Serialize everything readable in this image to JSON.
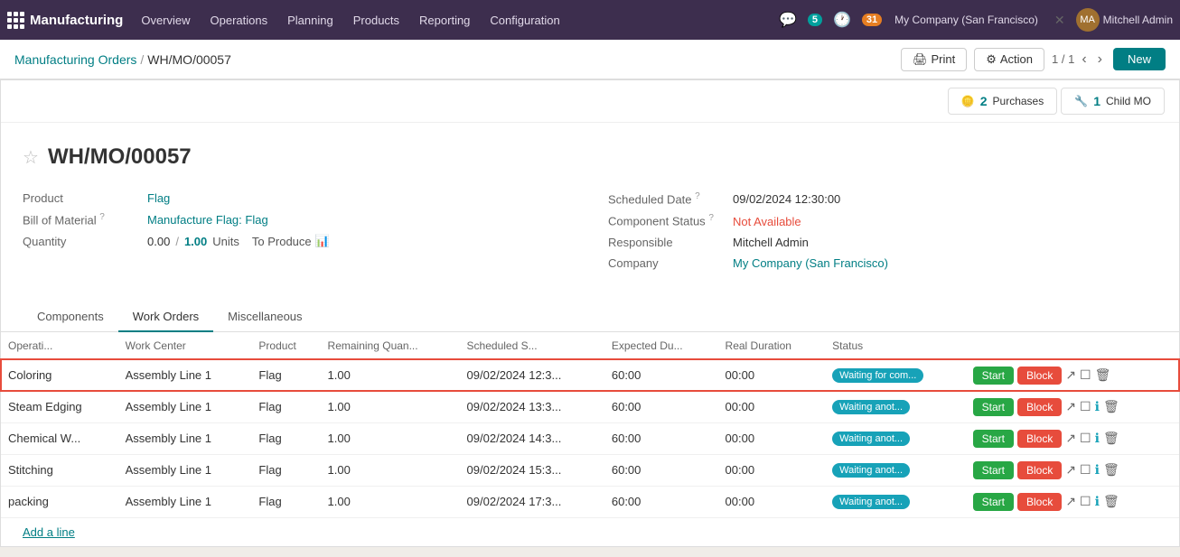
{
  "navbar": {
    "app_name": "Manufacturing",
    "nav_items": [
      "Overview",
      "Operations",
      "Planning",
      "Products",
      "Reporting",
      "Configuration"
    ],
    "badge_messages": "5",
    "badge_activity": "31",
    "company": "My Company (San Francisco)",
    "user": "Mitchell Admin"
  },
  "breadcrumb": {
    "parent": "Manufacturing Orders",
    "separator": "/",
    "current": "WH/MO/00057"
  },
  "toolbar": {
    "print_label": "Print",
    "action_label": "Action",
    "page_info": "1 / 1",
    "new_label": "New"
  },
  "smart_buttons": {
    "purchases_count": "2",
    "purchases_label": "Purchases",
    "child_mo_count": "1",
    "child_mo_label": "Child MO"
  },
  "form": {
    "title": "WH/MO/00057",
    "product_label": "Product",
    "product_value": "Flag",
    "bom_label": "Bill of Material",
    "bom_help": "?",
    "bom_value": "Manufacture Flag: Flag",
    "quantity_label": "Quantity",
    "quantity_current": "0.00",
    "quantity_target": "1.00",
    "quantity_unit": "Units",
    "to_produce_label": "To Produce",
    "scheduled_date_label": "Scheduled Date",
    "scheduled_date_help": "?",
    "scheduled_date_value": "09/02/2024 12:30:00",
    "component_status_label": "Component Status",
    "component_status_help": "?",
    "component_status_value": "Not Available",
    "responsible_label": "Responsible",
    "responsible_value": "Mitchell Admin",
    "company_label": "Company",
    "company_value": "My Company (San Francisco)"
  },
  "tabs": [
    {
      "label": "Components",
      "active": false
    },
    {
      "label": "Work Orders",
      "active": true
    },
    {
      "label": "Miscellaneous",
      "active": false
    }
  ],
  "table": {
    "columns": [
      "Operati...",
      "Work Center",
      "Product",
      "Remaining Quan...",
      "Scheduled S...",
      "Expected Du...",
      "Real Duration",
      "Status"
    ],
    "rows": [
      {
        "operation": "Coloring",
        "work_center": "Assembly Line 1",
        "product": "Flag",
        "remaining_qty": "1.00",
        "scheduled_start": "09/02/2024 12:3...",
        "expected_duration": "60:00",
        "real_duration": "00:00",
        "status": "Waiting for com...",
        "status_class": "waiting-comp",
        "highlighted": true
      },
      {
        "operation": "Steam Edging",
        "work_center": "Assembly Line 1",
        "product": "Flag",
        "remaining_qty": "1.00",
        "scheduled_start": "09/02/2024 13:3...",
        "expected_duration": "60:00",
        "real_duration": "00:00",
        "status": "Waiting anot...",
        "status_class": "waiting-anot",
        "highlighted": false
      },
      {
        "operation": "Chemical W...",
        "work_center": "Assembly Line 1",
        "product": "Flag",
        "remaining_qty": "1.00",
        "scheduled_start": "09/02/2024 14:3...",
        "expected_duration": "60:00",
        "real_duration": "00:00",
        "status": "Waiting anot...",
        "status_class": "waiting-anot",
        "highlighted": false
      },
      {
        "operation": "Stitching",
        "work_center": "Assembly Line 1",
        "product": "Flag",
        "remaining_qty": "1.00",
        "scheduled_start": "09/02/2024 15:3...",
        "expected_duration": "60:00",
        "real_duration": "00:00",
        "status": "Waiting anot...",
        "status_class": "waiting-anot",
        "highlighted": false
      },
      {
        "operation": "packing",
        "work_center": "Assembly Line 1",
        "product": "Flag",
        "remaining_qty": "1.00",
        "scheduled_start": "09/02/2024 17:3...",
        "expected_duration": "60:00",
        "real_duration": "00:00",
        "status": "Waiting anot...",
        "status_class": "waiting-anot",
        "highlighted": false
      }
    ],
    "start_label": "Start",
    "block_label": "Block",
    "add_line_label": "Add a line"
  }
}
